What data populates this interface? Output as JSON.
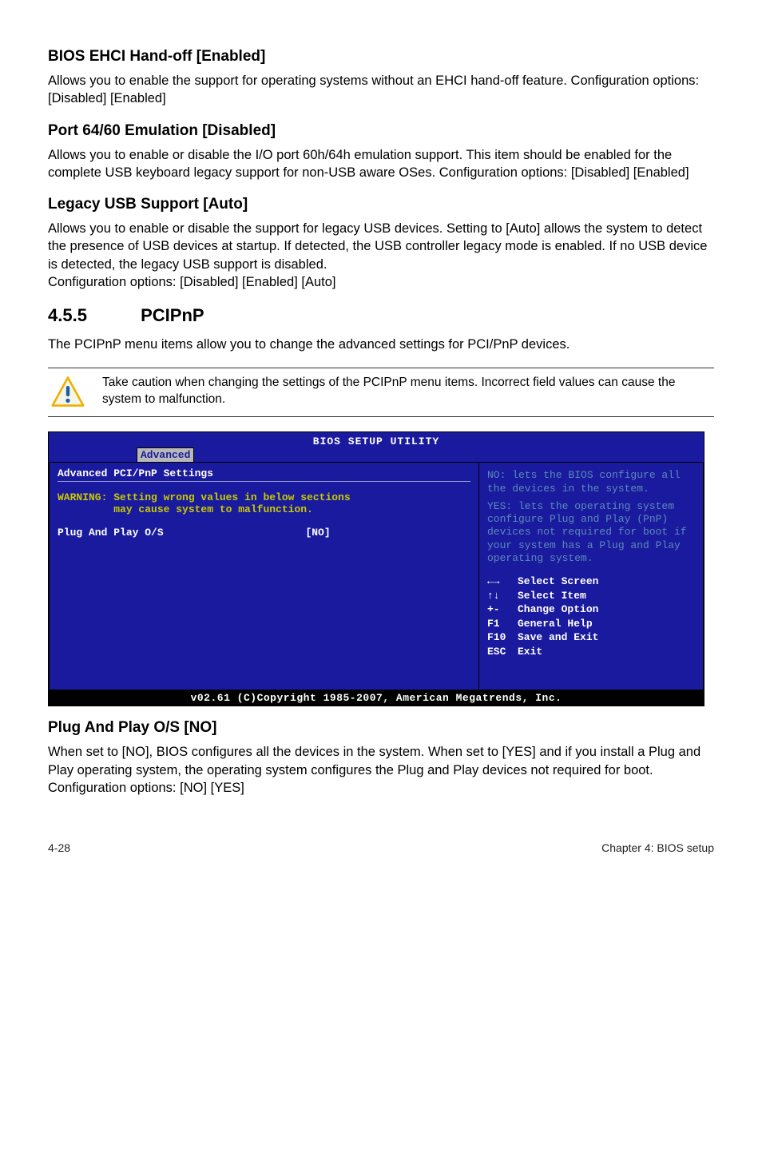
{
  "sections": {
    "s1_title": "BIOS EHCI Hand-off [Enabled]",
    "s1_body": "Allows you to enable the support for operating systems without an EHCI hand-off feature. Configuration options: [Disabled] [Enabled]",
    "s2_title": "Port 64/60 Emulation [Disabled]",
    "s2_body": "Allows you to enable or disable the I/O port 60h/64h emulation support. This item should be enabled for the complete USB keyboard legacy support for non-USB aware OSes. Configuration options: [Disabled] [Enabled]",
    "s3_title": "Legacy USB Support [Auto]",
    "s3_body1": "Allows you to enable or disable the support for legacy USB devices. Setting to [Auto] allows the system to detect the presence of USB devices at startup. If detected, the USB controller legacy mode is enabled. If no USB device is detected, the legacy USB support is disabled.",
    "s3_body2": "Configuration options: [Disabled] [Enabled] [Auto]"
  },
  "chapter": {
    "num": "4.5.5",
    "title": "PCIPnP",
    "intro": "The PCIPnP menu items allow you to change the advanced settings for PCI/PnP devices."
  },
  "note": "Take caution when changing the settings of the PCIPnP menu items. Incorrect field values can cause the system to malfunction.",
  "bios": {
    "title": "BIOS SETUP UTILITY",
    "tab": "Advanced",
    "left_title": "Advanced PCI/PnP Settings",
    "warn1": "WARNING: Setting wrong values in below sections",
    "warn2": "         may cause system to malfunction.",
    "opt_label": "Plug And Play O/S",
    "opt_value": "[NO]",
    "help1": "NO: lets the BIOS configure all the devices in the system.",
    "help2": "YES: lets the operating system configure Plug and Play (PnP) devices not required for boot if your system has a Plug and Play operating system.",
    "nav": {
      "l1k": "←→",
      "l1t": "Select Screen",
      "l2k": "↑↓",
      "l2t": "Select Item",
      "l3k": "+-",
      "l3t": "Change Option",
      "l4k": "F1",
      "l4t": "General Help",
      "l5k": "F10",
      "l5t": "Save and Exit",
      "l6k": "ESC",
      "l6t": "Exit"
    },
    "footer": "v02.61 (C)Copyright 1985-2007, American Megatrends, Inc."
  },
  "plug": {
    "title": "Plug And Play O/S [NO]",
    "body1": "When set to [NO], BIOS configures all the devices in the system. When set to [YES] and if you install a Plug and Play operating system, the operating system configures the Plug and Play devices not required for boot.",
    "body2": "Configuration options: [NO] [YES]"
  },
  "footer": {
    "left": "4-28",
    "right": "Chapter 4: BIOS setup"
  }
}
